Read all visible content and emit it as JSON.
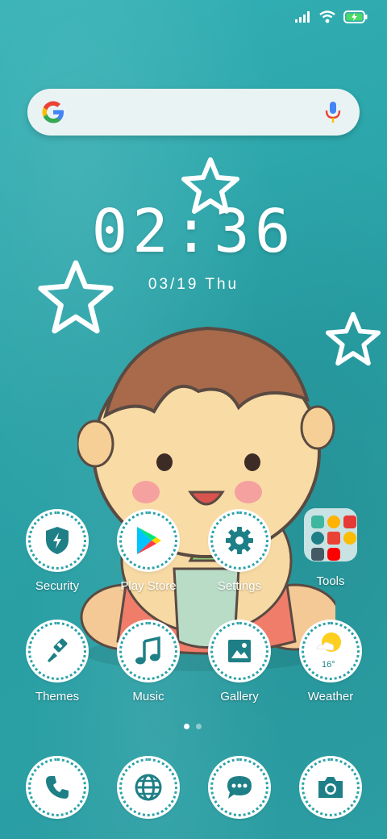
{
  "status_bar": {
    "signal_icon": "signal-icon",
    "wifi_icon": "wifi-icon",
    "battery_icon": "battery-charging-icon"
  },
  "search": {
    "logo_icon": "google-g-icon",
    "mic_icon": "mic-icon"
  },
  "clock": {
    "time": "02:36",
    "date": "03/19  Thu"
  },
  "apps_row1": [
    {
      "label": "Security",
      "icon": "shield-icon"
    },
    {
      "label": "Play Store",
      "icon": "play-store-icon"
    },
    {
      "label": "Settings",
      "icon": "gear-icon"
    },
    {
      "label": "Tools",
      "icon": "folder-icon"
    }
  ],
  "apps_row2": [
    {
      "label": "Themes",
      "icon": "paintbrush-icon"
    },
    {
      "label": "Music",
      "icon": "music-note-icon"
    },
    {
      "label": "Gallery",
      "icon": "image-icon"
    },
    {
      "label": "Weather",
      "icon": "weather-sun-icon",
      "temp": "16°"
    }
  ],
  "dock": [
    {
      "icon": "phone-icon"
    },
    {
      "icon": "globe-icon"
    },
    {
      "icon": "chat-bubble-icon"
    },
    {
      "icon": "camera-icon"
    }
  ],
  "page_indicator": {
    "total": 2,
    "active": 1
  },
  "colors": {
    "accent": "#2aa3a8",
    "icon_teal": "#1e7f86",
    "text": "#ffffff"
  }
}
